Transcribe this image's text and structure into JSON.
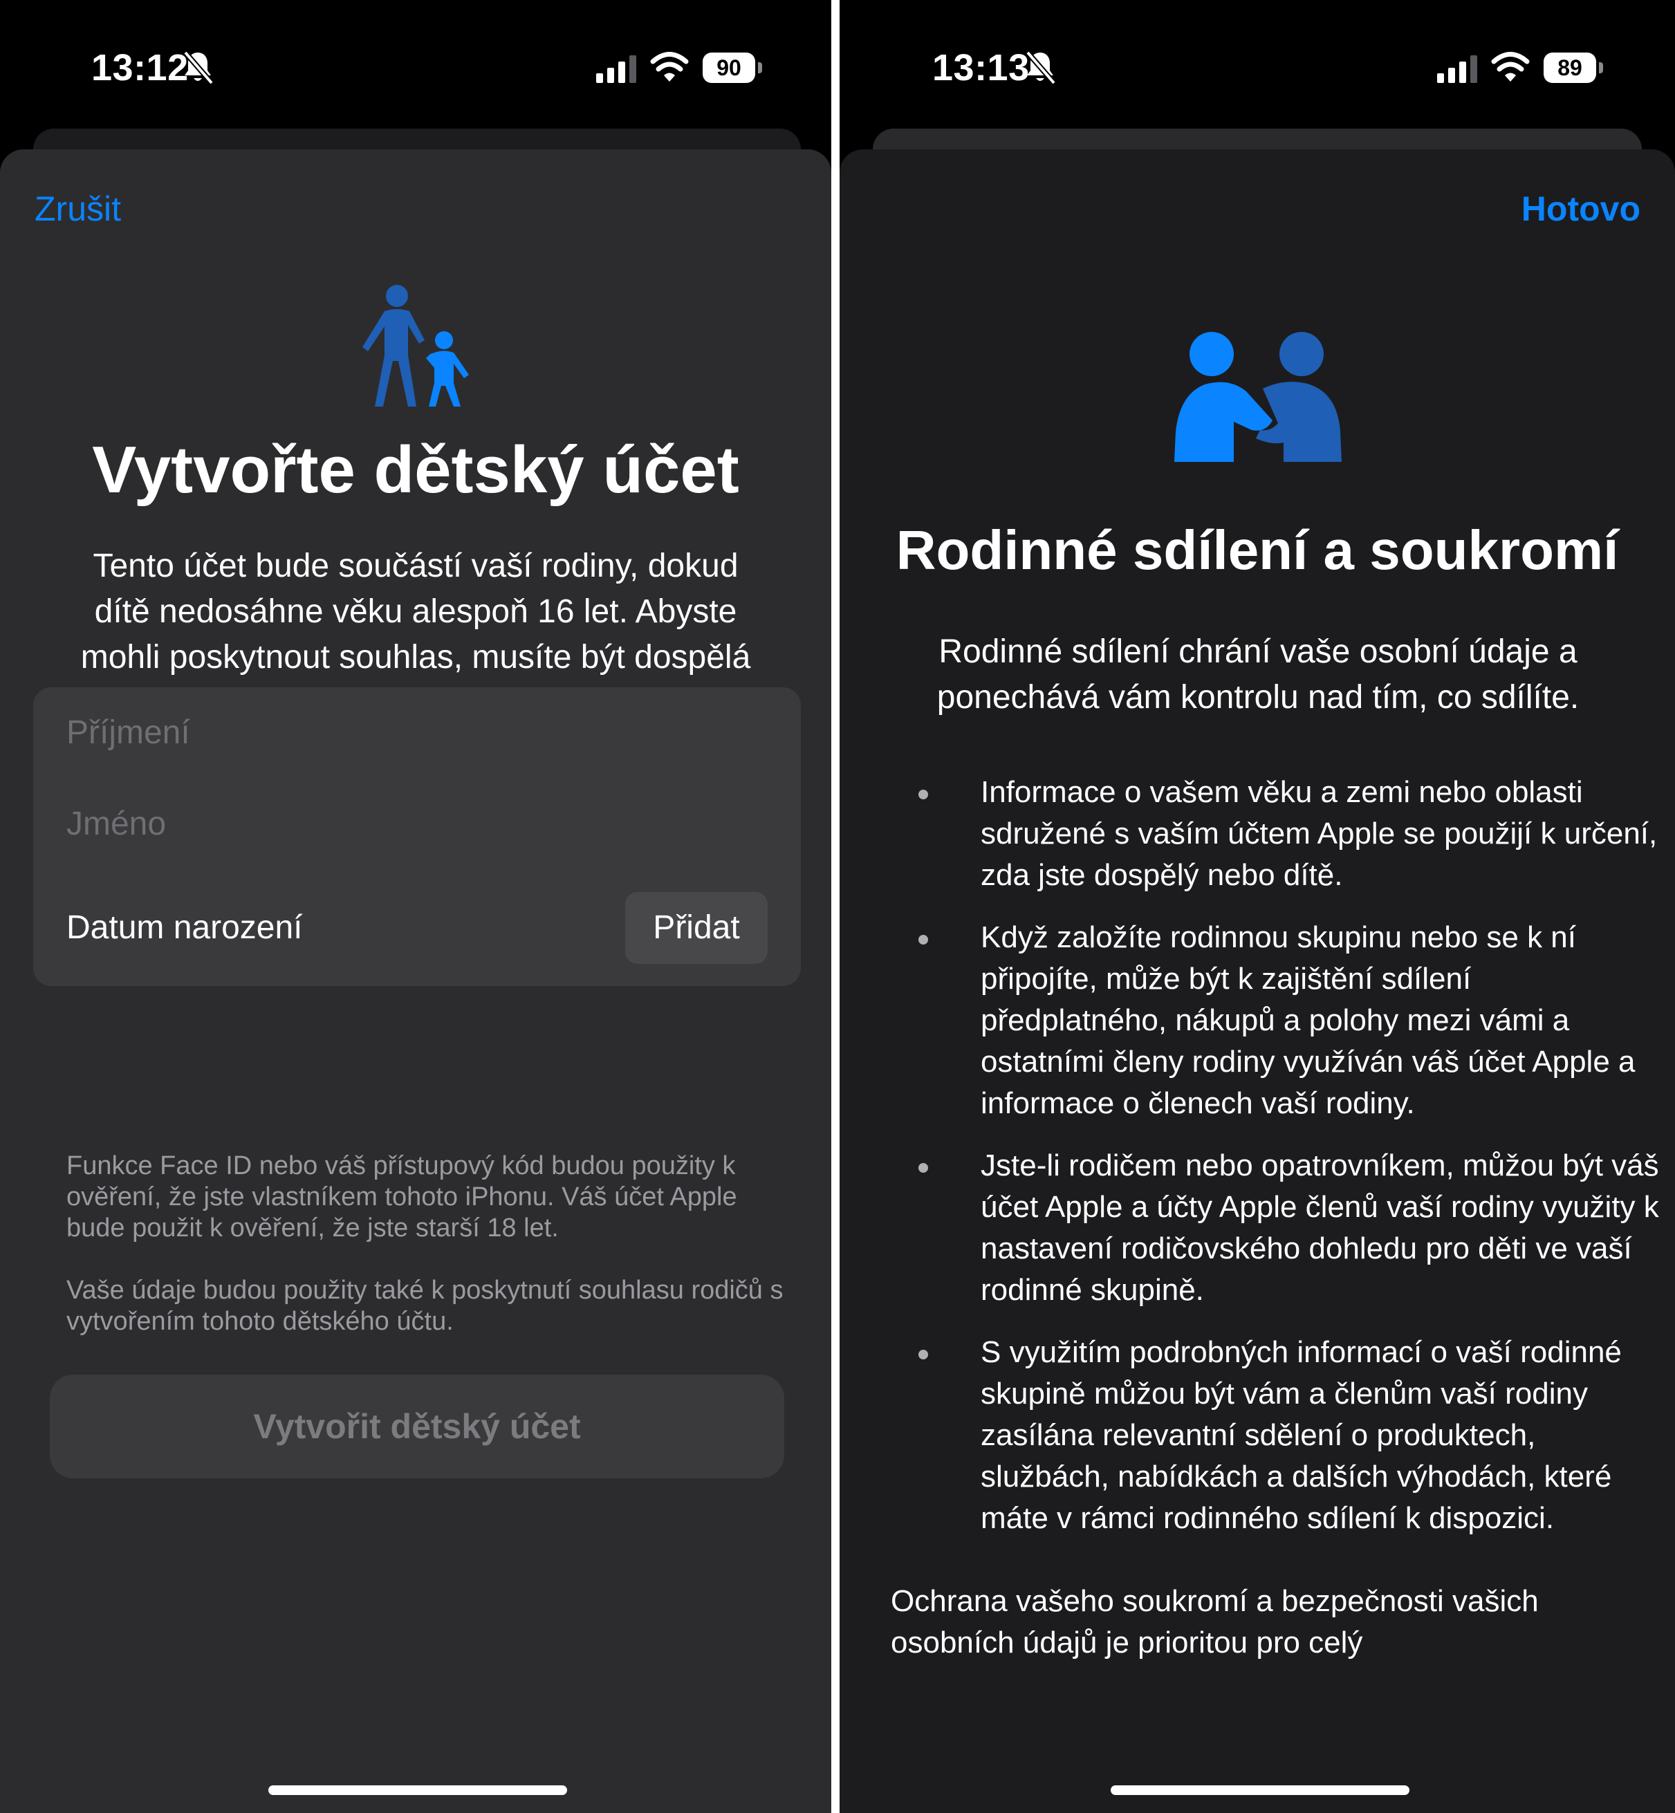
{
  "left_screen": {
    "status": {
      "time": "13:12",
      "battery": "90"
    },
    "nav": {
      "cancel_label": "Zrušit"
    },
    "title": "Vytvořte dětský účet",
    "description": "Tento účet bude součástí vaší rodiny, dokud dítě nedosáhne věku alespoň 16 let. Abyste mohli poskytnout souhlas, musíte být dospělá osoba a rodič dítěte nebo zákonem stanovená osoba odpovědná za výchovu.",
    "form": {
      "surname_placeholder": "Příjmení",
      "name_placeholder": "Jméno",
      "birthdate_label": "Datum narození",
      "add_button_label": "Přidat"
    },
    "footnotes": [
      "Funkce Face ID nebo váš přístupový kód budou použity k ověření, že jste vlastníkem tohoto iPhonu. Váš účet Apple bude použit k ověření, že jste starší 18 let.",
      "Vaše údaje budou použity také k poskytnutí souhlasu rodičů s vytvořením tohoto dětského účtu."
    ],
    "create_button_label": "Vytvořit dětský účet"
  },
  "right_screen": {
    "status": {
      "time": "13:13",
      "battery": "89"
    },
    "nav": {
      "done_label": "Hotovo"
    },
    "title": "Rodinné sdílení a soukromí",
    "intro": "Rodinné sdílení chrání vaše osobní údaje a ponechává vám kontrolu nad tím, co sdílíte.",
    "bullets": [
      "Informace o vašem věku a zemi nebo oblasti sdružené s vaším účtem Apple se použijí k určení, zda jste dospělý nebo dítě.",
      "Když založíte rodinnou skupinu nebo se k ní připojíte, může být k zajištění sdílení předplatného, nákupů a polohy mezi vámi a ostatními členy rodiny využíván váš účet Apple a informace o členech vaší rodiny.",
      "Jste-li rodičem nebo opatrovníkem, můžou být váš účet Apple a účty Apple členů vaší rodiny využity k nastavení rodičovského dohledu pro děti ve vaší rodinné skupině.",
      "S využitím podrobných informací o vaší rodinné skupině můžou být vám a členům vaší rodiny zasílána relevantní sdělení o produktech, službách, nabídkách a dalších výhodách, které máte v rámci rodinného sdílení k dispozici."
    ],
    "closing": "Ochrana vašeho soukromí a bezpečnosti vašich osobních údajů je prioritou pro celý"
  },
  "colors": {
    "accent": "#0a84ff",
    "icon_dark_blue": "#1f5fb5",
    "icon_light_blue": "#0a84ff"
  },
  "icons": {
    "left_hero": "parent-child-walking-icon",
    "right_hero": "two-people-handshake-icon"
  }
}
